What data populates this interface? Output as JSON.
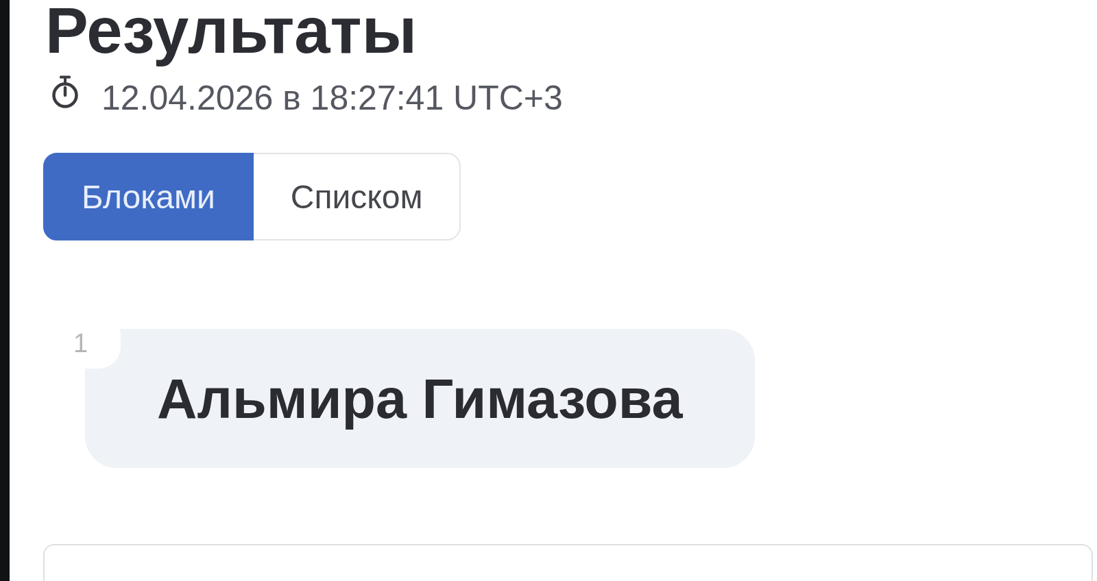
{
  "page": {
    "title": "Результаты",
    "timestamp": "12.04.2026 в 18:27:41 UTC+3"
  },
  "view_toggle": [
    {
      "label": "Блоками",
      "selected": true
    },
    {
      "label": "Списком",
      "selected": false
    }
  ],
  "results": [
    {
      "rank": "1",
      "name": "Альмира Гимазова"
    }
  ]
}
